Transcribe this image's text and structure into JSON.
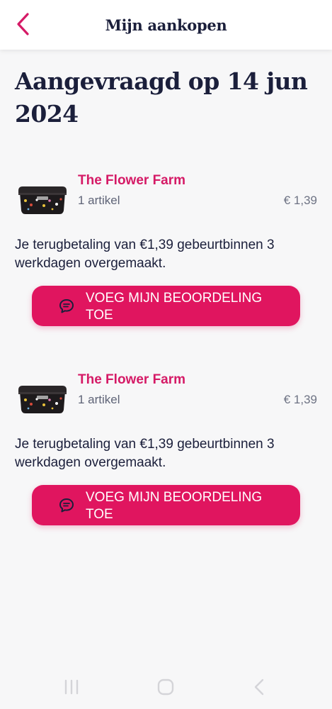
{
  "header": {
    "title": "Mijn aankopen",
    "back_icon": "chevron-left-icon",
    "accent_color": "#d51a66"
  },
  "page": {
    "title": "Aangevraagd op 14 jun 2024"
  },
  "orders": [
    {
      "shop": "The Flower Farm",
      "items": "1 artikel",
      "price": "€ 1,39",
      "refund_text": "Je terugbetaling van €1,39 gebeurtbinnen 3 werkdagen overgemaakt.",
      "button_label": "VOEG MIJN BEOORDELING TOE",
      "button_icon": "speech-bubble-icon"
    },
    {
      "shop": "The Flower Farm",
      "items": "1 artikel",
      "price": "€ 1,39",
      "refund_text": "Je terugbetaling van €1,39 gebeurtbinnen 3 werkdagen overgemaakt.",
      "button_label": "VOEG MIJN BEOORDELING TOE",
      "button_icon": "speech-bubble-icon"
    }
  ],
  "system_nav": {
    "recent_icon": "recent-apps-icon",
    "home_icon": "home-icon",
    "back_icon": "back-icon"
  },
  "colors": {
    "brand_pink": "#e0155f",
    "shop_name": "#d51a66",
    "heading": "#1b1f3b",
    "muted": "#5f6477",
    "background": "#f7f7f8"
  }
}
